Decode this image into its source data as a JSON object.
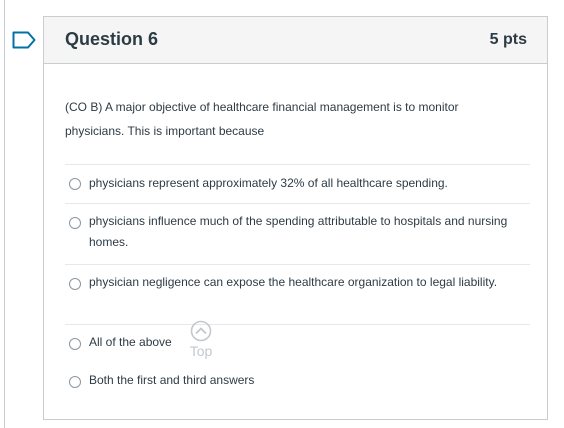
{
  "question": {
    "title": "Question 6",
    "points": "5 pts",
    "text": "(CO B) A major objective of healthcare financial management is to monitor physicians. This is important because"
  },
  "answers": [
    {
      "label": "physicians represent approximately 32% of all healthcare spending."
    },
    {
      "label": "physicians influence much of the spending attributable to hospitals and nursing homes."
    },
    {
      "label": "physician negligence can expose the healthcare organization to legal liability."
    },
    {
      "label": "All of the above"
    },
    {
      "label": "Both the first and third answers"
    }
  ],
  "scroll_top": {
    "label": "Top",
    "icon": "chevron-up-circle-icon"
  },
  "flag": {
    "icon": "bookmark-flag-icon",
    "color": "#0770a3"
  }
}
